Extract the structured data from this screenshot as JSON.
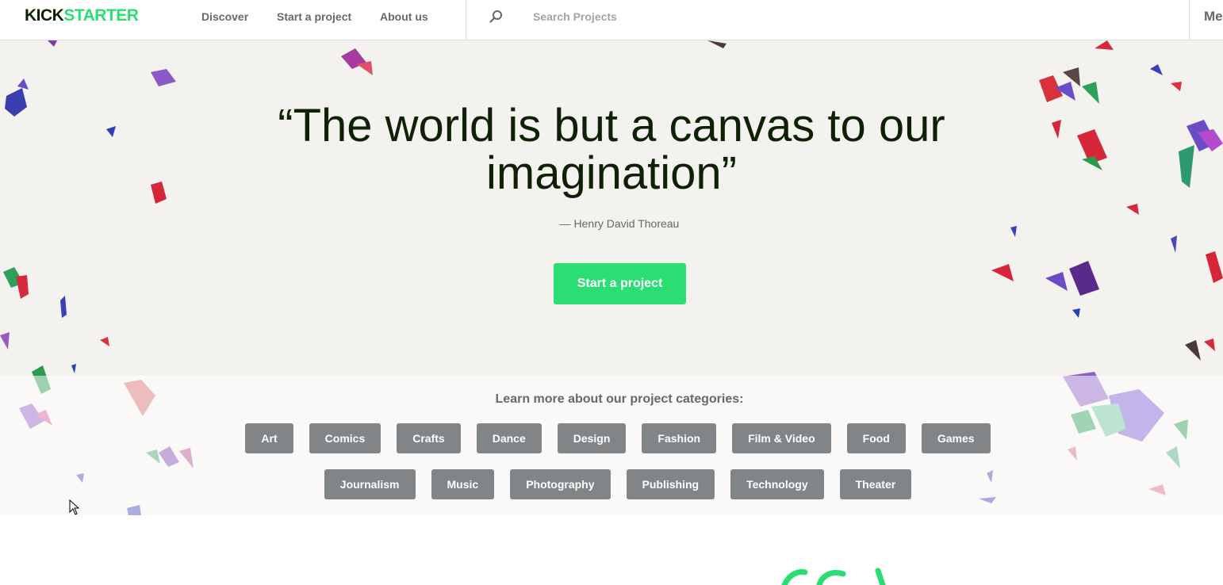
{
  "brand": {
    "logo_part1": "KICK",
    "logo_part2": "STARTER",
    "dark_color": "#0f2105",
    "accent_color": "#2bde73"
  },
  "nav": {
    "links": [
      "Discover",
      "Start a project",
      "About us"
    ],
    "search_icon": "search-icon",
    "search_placeholder": "Search Projects",
    "me_label": "Me"
  },
  "hero": {
    "quote": "“The world is but a canvas to our imagination”",
    "attribution": "— Henry David Thoreau",
    "cta_label": "Start a project",
    "background_color": "#f3f2ee"
  },
  "categories": {
    "heading": "Learn more about our project categories:",
    "row1": [
      "Art",
      "Comics",
      "Crafts",
      "Dance",
      "Design",
      "Fashion",
      "Film & Video",
      "Food",
      "Games"
    ],
    "row2": [
      "Journalism",
      "Music",
      "Photography",
      "Publishing",
      "Technology",
      "Theater"
    ],
    "pill_color": "#828587"
  }
}
